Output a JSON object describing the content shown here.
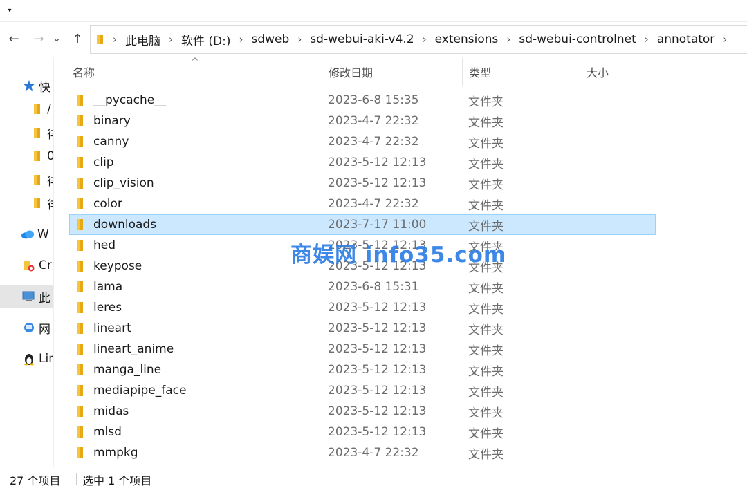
{
  "ribbon": {
    "toggle_glyph": "▾"
  },
  "nav": {
    "back": "←",
    "forward": "→",
    "recent": "⌄",
    "up": "↑"
  },
  "address": {
    "crumbs": [
      "此电脑",
      "软件 (D:)",
      "sdweb",
      "sd-webui-aki-v4.2",
      "extensions",
      "sd-webui-controlnet",
      "annotator"
    ],
    "separator": "›"
  },
  "nav_pane": {
    "items": [
      {
        "label": "快",
        "icon": "star-icon"
      },
      {
        "label": "/",
        "icon": "folder-icon"
      },
      {
        "label": "徘",
        "icon": "folder-icon"
      },
      {
        "label": "0",
        "icon": "folder-icon"
      },
      {
        "label": "徘",
        "icon": "folder-icon"
      },
      {
        "label": "徘",
        "icon": "folder-icon"
      },
      {
        "label": "W",
        "icon": "cloud-icon"
      },
      {
        "label": "Cr",
        "icon": "creative-cloud-icon"
      },
      {
        "label": "此",
        "icon": "computer-icon"
      },
      {
        "label": "网",
        "icon": "network-icon"
      },
      {
        "label": "Lir",
        "icon": "linux-icon"
      }
    ]
  },
  "columns": {
    "name": "名称",
    "date": "修改日期",
    "type": "类型",
    "size": "大小",
    "sort_glyph": "^"
  },
  "files": [
    {
      "name": "__pycache__",
      "date": "2023-6-8 15:35",
      "type": "文件夹"
    },
    {
      "name": "binary",
      "date": "2023-4-7 22:32",
      "type": "文件夹"
    },
    {
      "name": "canny",
      "date": "2023-4-7 22:32",
      "type": "文件夹"
    },
    {
      "name": "clip",
      "date": "2023-5-12 12:13",
      "type": "文件夹"
    },
    {
      "name": "clip_vision",
      "date": "2023-5-12 12:13",
      "type": "文件夹"
    },
    {
      "name": "color",
      "date": "2023-4-7 22:32",
      "type": "文件夹"
    },
    {
      "name": "downloads",
      "date": "2023-7-17 11:00",
      "type": "文件夹",
      "selected": true
    },
    {
      "name": "hed",
      "date": "2023-5-12 12:13",
      "type": "文件夹"
    },
    {
      "name": "keypose",
      "date": "2023-5-12 12:13",
      "type": "文件夹"
    },
    {
      "name": "lama",
      "date": "2023-6-8 15:31",
      "type": "文件夹"
    },
    {
      "name": "leres",
      "date": "2023-5-12 12:13",
      "type": "文件夹"
    },
    {
      "name": "lineart",
      "date": "2023-5-12 12:13",
      "type": "文件夹"
    },
    {
      "name": "lineart_anime",
      "date": "2023-5-12 12:13",
      "type": "文件夹"
    },
    {
      "name": "manga_line",
      "date": "2023-5-12 12:13",
      "type": "文件夹"
    },
    {
      "name": "mediapipe_face",
      "date": "2023-5-12 12:13",
      "type": "文件夹"
    },
    {
      "name": "midas",
      "date": "2023-5-12 12:13",
      "type": "文件夹"
    },
    {
      "name": "mlsd",
      "date": "2023-5-12 12:13",
      "type": "文件夹"
    },
    {
      "name": "mmpkg",
      "date": "2023-4-7 22:32",
      "type": "文件夹"
    }
  ],
  "status": {
    "count": "27 个项目",
    "selection": "选中 1 个项目"
  },
  "watermark": "商娱网 info35.com",
  "colors": {
    "folder": "#f5c542",
    "selection": "#cce8ff",
    "selection_border": "#99d1ff",
    "watermark": "#2d7ee6"
  }
}
